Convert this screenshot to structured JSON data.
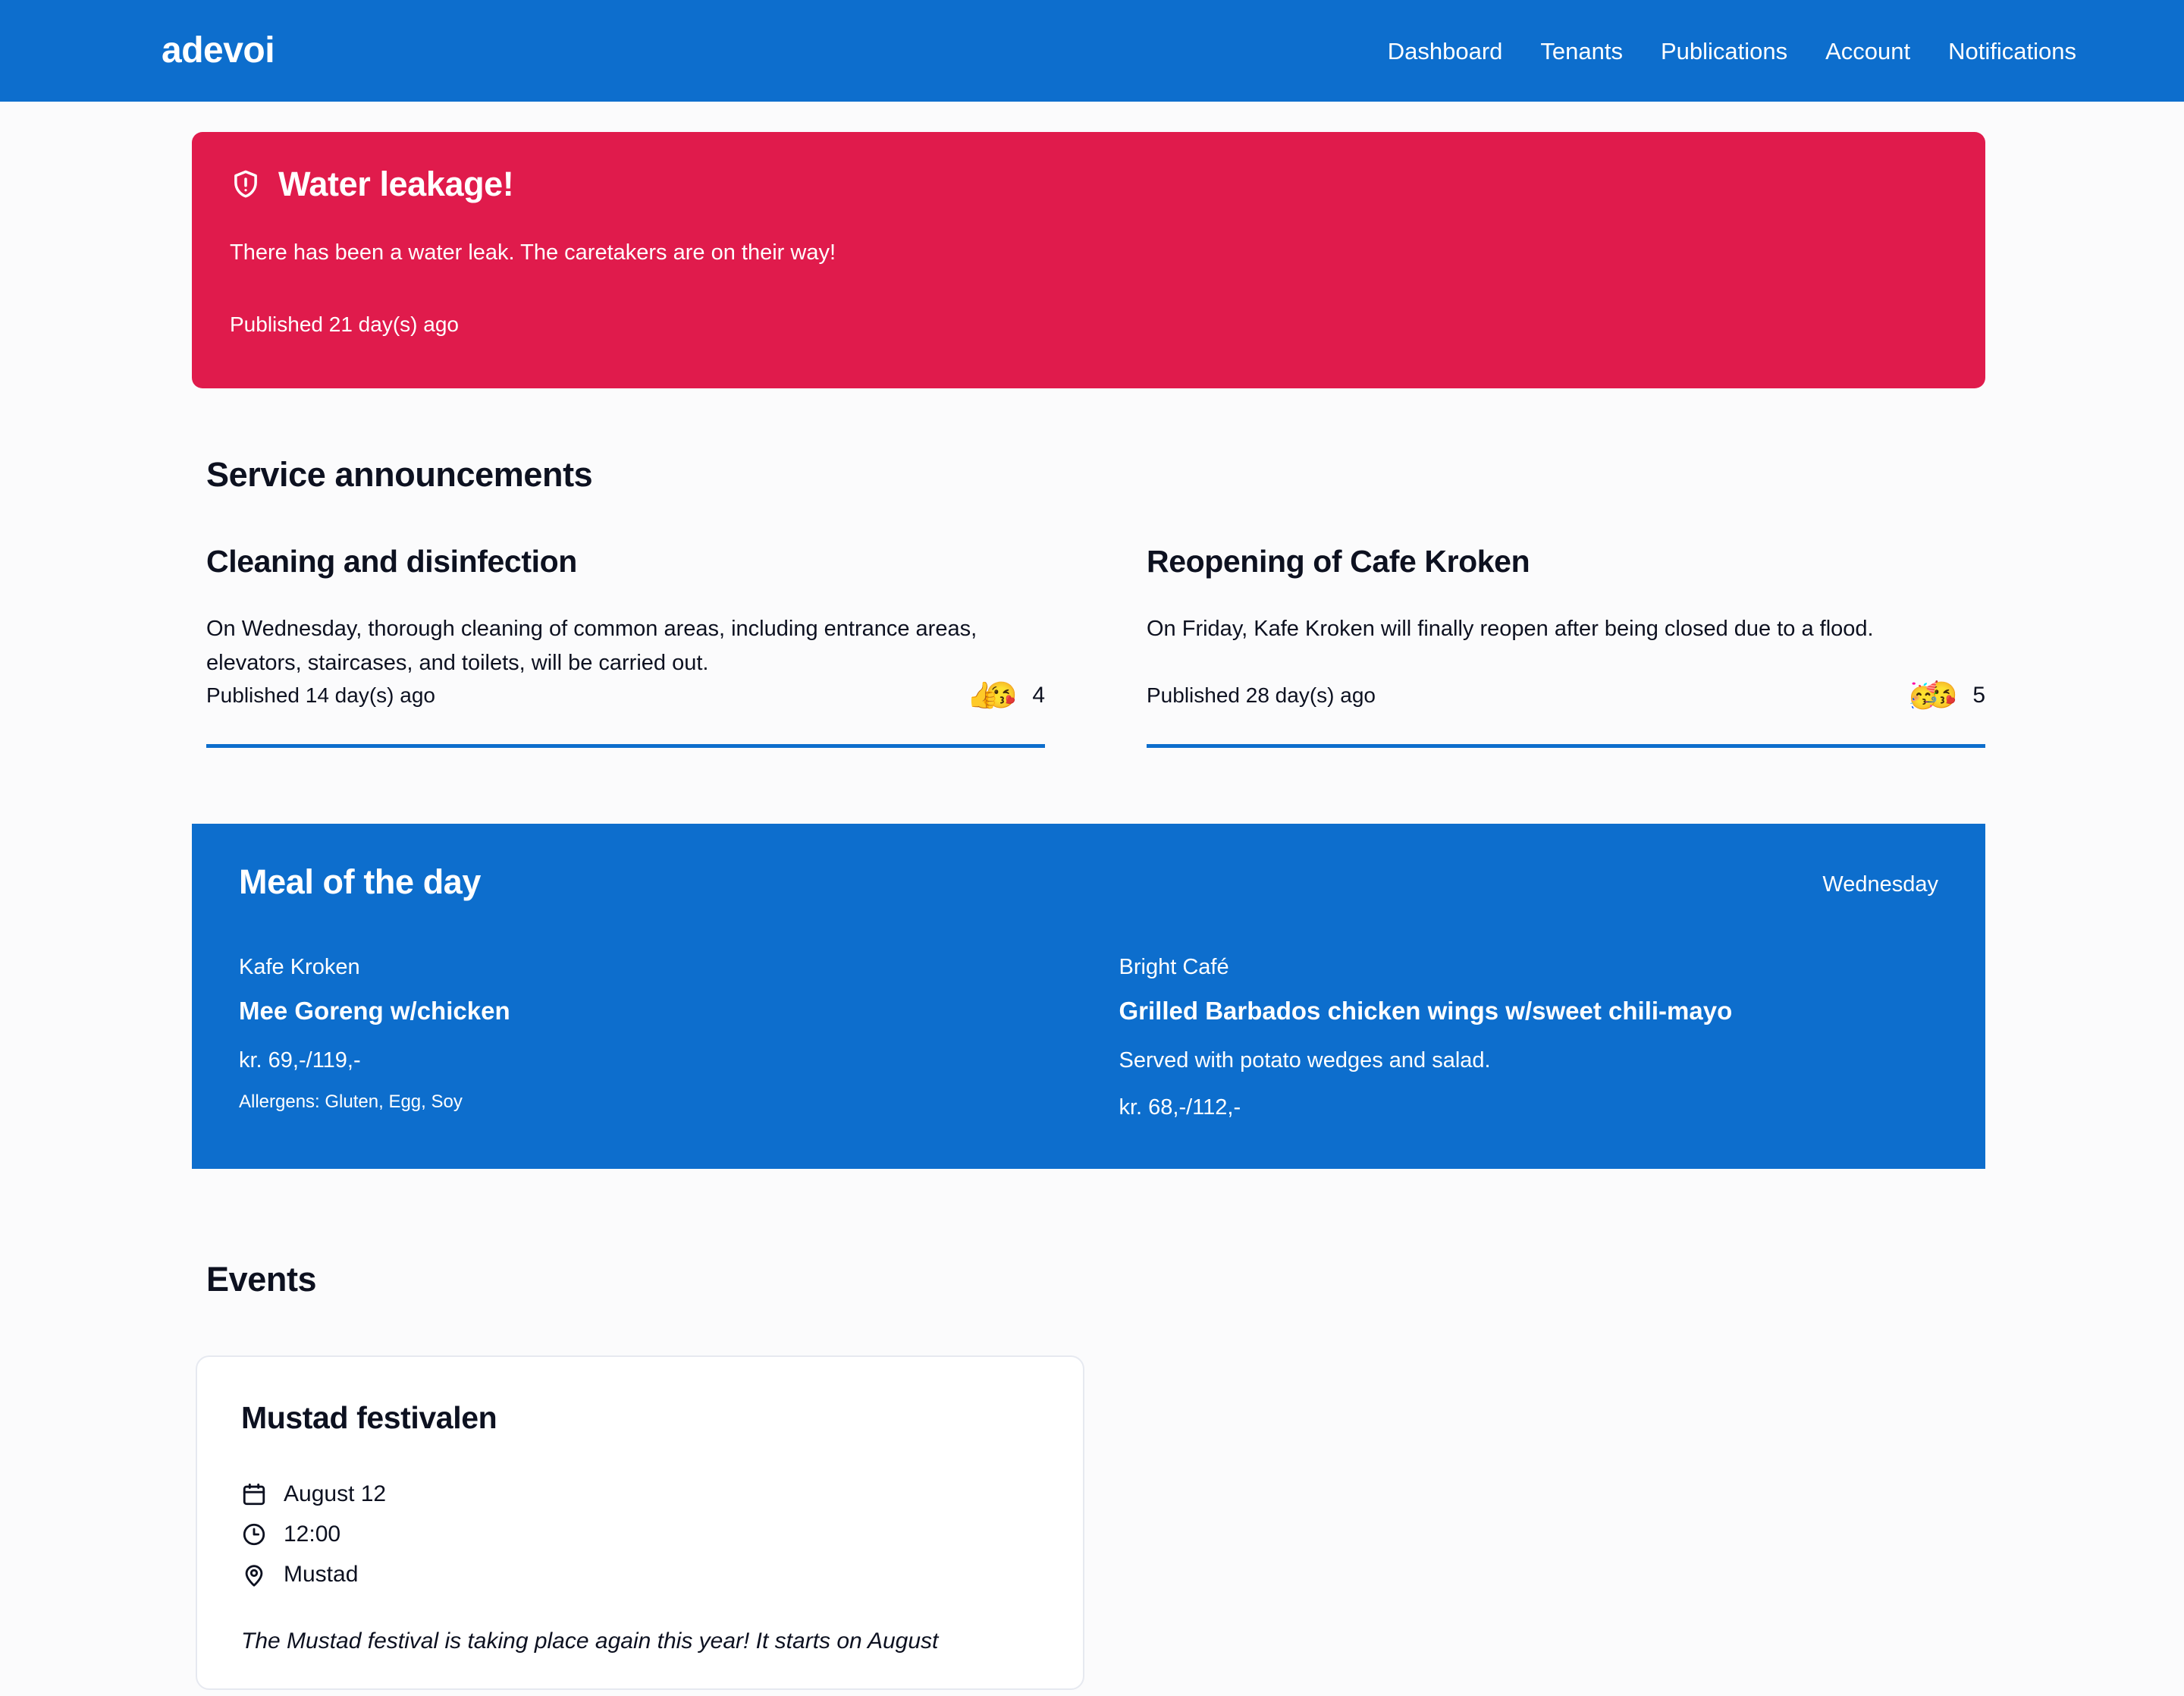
{
  "header": {
    "brand": "adevoi",
    "nav": [
      {
        "label": "Dashboard"
      },
      {
        "label": "Tenants"
      },
      {
        "label": "Publications"
      },
      {
        "label": "Account"
      },
      {
        "label": "Notifications"
      }
    ]
  },
  "alert": {
    "icon": "shield-alert-icon",
    "title": "Water leakage!",
    "body": "There has been a water leak. The caretakers are on their way!",
    "published": "Published 21 day(s) ago",
    "background_color": "#e01b4c"
  },
  "service_announcements": {
    "section_title": "Service announcements",
    "items": [
      {
        "title": "Cleaning and disinfection",
        "body": "On Wednesday, thorough cleaning of common areas, including entrance areas, elevators, staircases, and toilets, will be carried out.",
        "published": "Published 14 day(s) ago",
        "reaction_emojis": [
          "👍",
          "😘"
        ],
        "reaction_count": "4"
      },
      {
        "title": "Reopening of Cafe Kroken",
        "body": "On Friday, Kafe Kroken will finally reopen after being closed due to a flood.",
        "published": "Published 28 day(s) ago",
        "reaction_emojis": [
          "🥳",
          "😘"
        ],
        "reaction_count": "5"
      }
    ],
    "rule_color": "#0d6ecd"
  },
  "meal_of_the_day": {
    "title": "Meal of the day",
    "day": "Wednesday",
    "background_color": "#0d6ecd",
    "items": [
      {
        "vendor": "Kafe Kroken",
        "dish": "Mee Goreng w/chicken",
        "price": "kr. 69,-/119,-",
        "description": "",
        "allergens": "Allergens: Gluten, Egg, Soy"
      },
      {
        "vendor": "Bright Café",
        "dish": "Grilled Barbados chicken wings w/sweet chili-mayo",
        "price": "kr. 68,-/112,-",
        "description": "Served with potato wedges and salad.",
        "allergens": ""
      }
    ]
  },
  "events": {
    "section_title": "Events",
    "cards": [
      {
        "name": "Mustad festivalen",
        "date_icon": "calendar-icon",
        "date": "August 12",
        "time_icon": "clock-icon",
        "time": "12:00",
        "location_icon": "map-pin-icon",
        "location": "Mustad",
        "description": "The Mustad festival is taking place again this year! It starts on August"
      }
    ]
  }
}
